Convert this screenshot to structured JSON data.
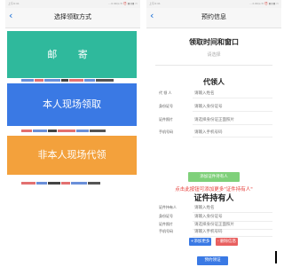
{
  "left_screen": {
    "status_time": "上午9:41",
    "status_icons": "…0.9K/s ✉ ⏰ ▮▮ ▮▮ ▭",
    "title": "选择领取方式",
    "options": [
      {
        "label": "邮 寄",
        "color": "#2fb99c"
      },
      {
        "label": "本人现场领取",
        "color": "#3a79e4"
      },
      {
        "label": "非本人现场代领",
        "color": "#f3a13c"
      }
    ]
  },
  "right_screen": {
    "status_time": "上午9:41",
    "status_icons": "…2.6K/s ✉ ⏰ ▮▮ ▮▮ ▭",
    "title": "预约信息",
    "time_window": {
      "heading": "领取时间和窗口",
      "placeholder": "请选择"
    },
    "agent": {
      "heading": "代领人",
      "fields": [
        {
          "label": "代 领 人",
          "placeholder": "请输入姓名"
        },
        {
          "label": "身份证号",
          "placeholder": "请输入身份证号"
        },
        {
          "label": "证件照片",
          "placeholder": "请选择身份证正面照片"
        },
        {
          "label": "手机号码",
          "placeholder": "请输入手机号码"
        }
      ],
      "add_button": "添加证件持有人"
    },
    "hint": "点击此按钮可添加更多\"证件持有人\"",
    "holder": {
      "heading": "证件持有人",
      "fields": [
        {
          "label": "证件持有人",
          "placeholder": "请输入姓名"
        },
        {
          "label": "身份证号",
          "placeholder": "请输入身份证号"
        },
        {
          "label": "证件照片",
          "placeholder": "请选择身份证正面照片"
        },
        {
          "label": "手机号码",
          "placeholder": "请输入手机号码"
        }
      ],
      "add_more_button": "+添加更多",
      "delete_button": "- 删除信息"
    },
    "submit_button": "预约领证"
  },
  "colors": {
    "mail": "#2fb99c",
    "self": "#3a79e4",
    "proxy": "#f3a13c",
    "add": "#7fd07a",
    "delete": "#e86060",
    "hint": "#e53935"
  }
}
